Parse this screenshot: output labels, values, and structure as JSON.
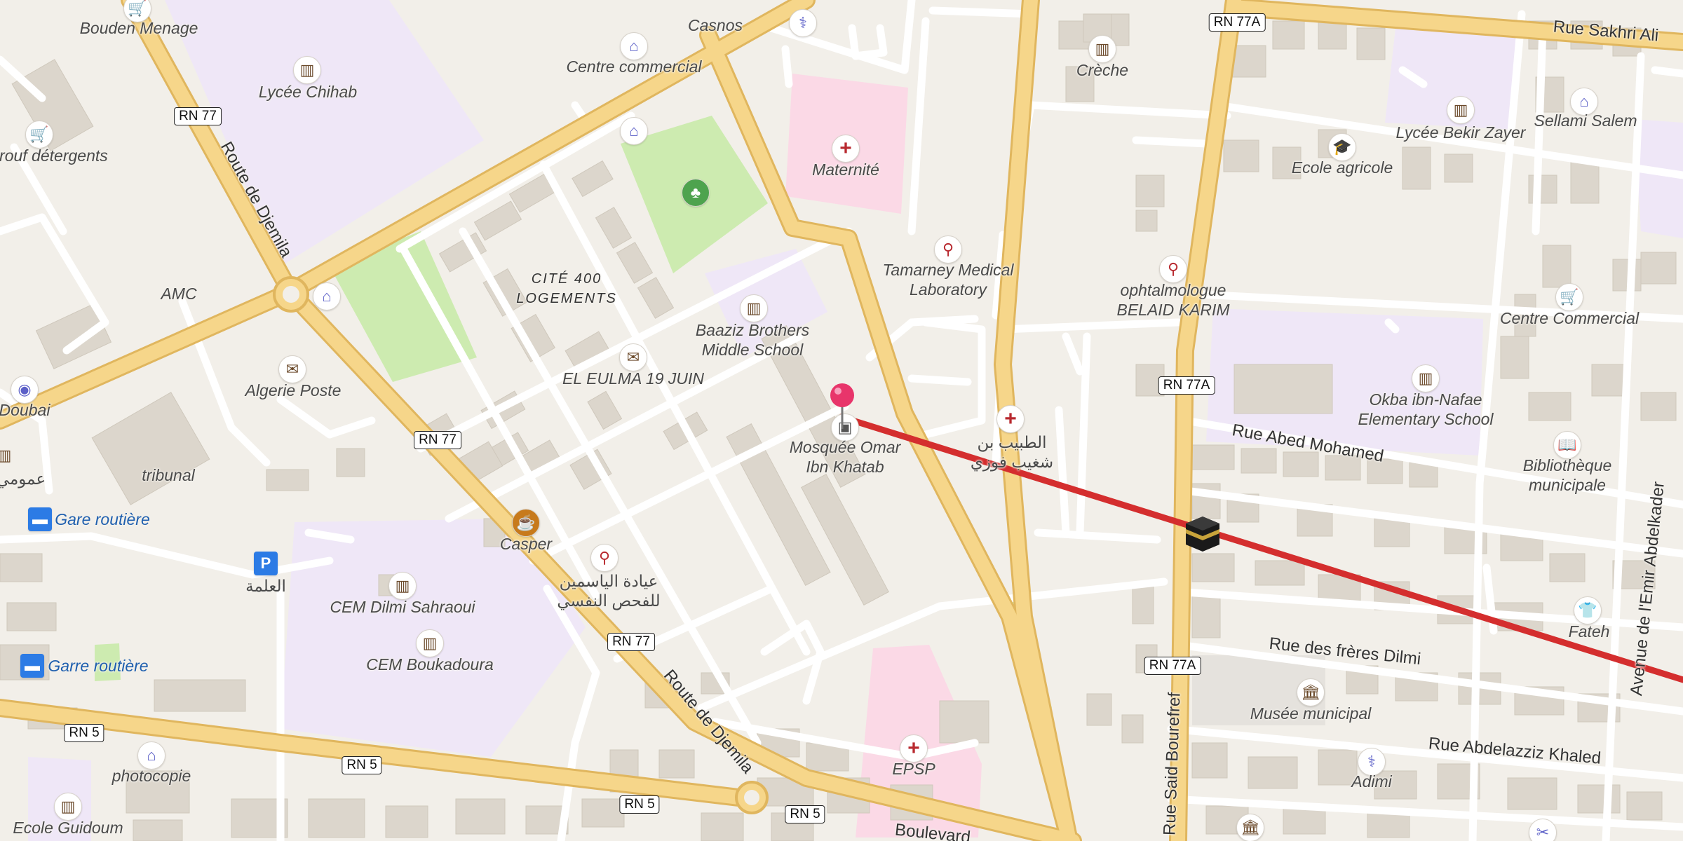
{
  "map": {
    "route_color": "#d42e2e",
    "colors": {
      "background": "#f2efe9",
      "primary_road": "#f6d68a",
      "residential_road": "#ffffff",
      "building": "#dcd6cc",
      "school_area": "#efe7f7",
      "hospital_area": "#fbd9e6",
      "park": "#cdebb0",
      "pin": "#e8356b"
    },
    "road_shields": [
      "RN 77",
      "RN 77",
      "RN 77",
      "RN 5",
      "RN 5",
      "RN 5",
      "RN 5",
      "RN 77A",
      "RN 77A",
      "RN 77A"
    ],
    "street_names": [
      "Route de Djemila",
      "Route de Djemila",
      "Rue Sakhri Ali",
      "Rue Abed Mohamed",
      "Rue des frères Dilmi",
      "Rue Abdelazziz Khaled",
      "Rue Said Bourefref",
      "Avenue de l'Emir Abdelkader",
      "Boulevard"
    ],
    "district": "CITÉ 400\nLOGEMENTS",
    "place_labels": [
      "Bouden Menage",
      "Casnos",
      "Lycée Chihab",
      "Centre commercial",
      "arouf détergents",
      "Maternité",
      "Crèche",
      "Lycée Bekir Zayer",
      "Sellami Salem",
      "Ecole agricole",
      "AMC",
      "Tamarney Medical\nLaboratory",
      "ophtalmologue\nBELAID KARIM",
      "Centre Commercial",
      "Baaziz Brothers\nMiddle School",
      "EL EULMA 19 JUIN",
      "Algerie Poste",
      "Doubai",
      "tribunal",
      "Mosquée Omar\nIbn Khatab",
      "الطبيب بن\nشغيب فوزي",
      "Okba ibn-Nafae\nElementary School",
      "Bibliothèque\nmunicipale",
      "Casper",
      "عيادة الياسمين\nللفحص النفسي",
      "CEM Dilmi Sahraoui",
      "CEM Boukadoura",
      "العلمة",
      "Fateh",
      "Musée municipal",
      "photocopie",
      "Adimi",
      "Ecole Guidoum",
      "EPSP",
      "عمومي"
    ],
    "transit_labels": [
      "Gare routière",
      "Garre routière"
    ],
    "icons": [
      "shopping-basket-icon",
      "shopping-cart-icon",
      "school-icon",
      "university-icon",
      "hospital-icon",
      "laboratory-icon",
      "post-office-icon",
      "camera-icon",
      "mosque-icon",
      "kaaba-icon",
      "cafe-icon",
      "bus-stop-icon",
      "parking-icon",
      "library-icon",
      "museum-icon",
      "clothes-icon",
      "pharmacy-icon",
      "tree-icon",
      "hairdresser-icon",
      "location-pin-icon"
    ]
  }
}
